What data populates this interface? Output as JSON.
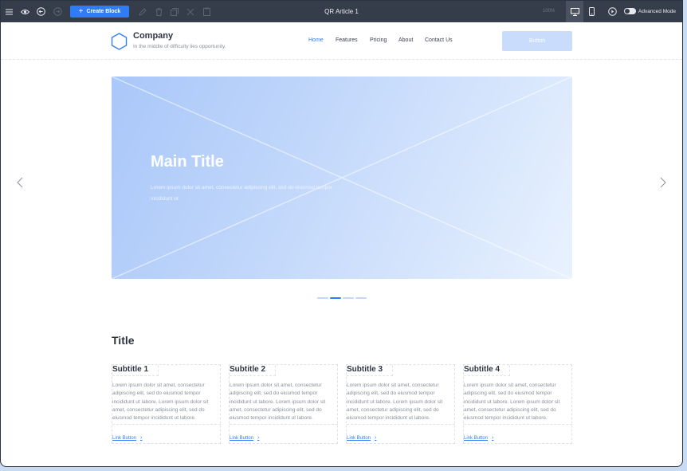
{
  "toolbar": {
    "create_block_label": "Create Block",
    "document_title": "QR Article 1",
    "zoom": "100%",
    "advanced_mode_label": "Advanced Mode"
  },
  "header": {
    "company": "Company",
    "tagline": "In the middle of difficulty lies opportunity.",
    "nav": [
      "Home",
      "Features",
      "Pricing",
      "About",
      "Contact Us"
    ],
    "active_nav": "Home",
    "button_label": "Button"
  },
  "hero": {
    "title": "Main Title",
    "text": "Lorem ipsum dolor sit amet, consectetur adipiscing elit, sed do eiusmod tempor incididunt ut",
    "slide_count": 4,
    "active_slide": 2
  },
  "features": {
    "title": "Title",
    "cards": [
      {
        "subtitle": "Subtitle 1",
        "text": "Lorem ipsum dolor sit amet, consectetur adipiscing elit, sed do eiusmod tempor incididunt ut labore. Lorem ipsum dolor sit amet, consectetur adipiscing elit, sed do eiusmod tempor incididunt ut labore.",
        "link": "Link Button"
      },
      {
        "subtitle": "Subtitle 2",
        "text": "Lorem ipsum dolor sit amet, consectetur adipiscing elit, sed do eiusmod tempor incididunt ut labore. Lorem ipsum dolor sit amet, consectetur adipiscing elit, sed do eiusmod tempor incididunt ut labore.",
        "link": "Link Button"
      },
      {
        "subtitle": "Subtitle 3",
        "text": "Lorem ipsum dolor sit amet, consectetur adipiscing elit, sed do eiusmod tempor incididunt ut labore. Lorem ipsum dolor sit amet, consectetur adipiscing elit, sed do eiusmod tempor incididunt ut labore.",
        "link": "Link Button"
      },
      {
        "subtitle": "Subtitle 4",
        "text": "Lorem ipsum dolor sit amet, consectetur adipiscing elit, sed do eiusmod tempor incididunt ut labore. Lorem ipsum dolor sit amet, consectetur adipiscing elit, sed do eiusmod tempor incididunt ut labore.",
        "link": "Link Button"
      }
    ]
  },
  "colors": {
    "toolbar_bg": "#363d4a",
    "accent": "#2f7df6",
    "hero_start": "#a9c7f9",
    "hero_end": "#e9f2fe"
  },
  "icons": {
    "toolbar": [
      "menu-icon",
      "eye-icon",
      "back-icon",
      "forward-icon",
      "pencil-icon",
      "trash-icon",
      "copy-icon",
      "cut-icon",
      "paste-icon",
      "desktop-icon",
      "mobile-icon",
      "play-icon"
    ]
  }
}
